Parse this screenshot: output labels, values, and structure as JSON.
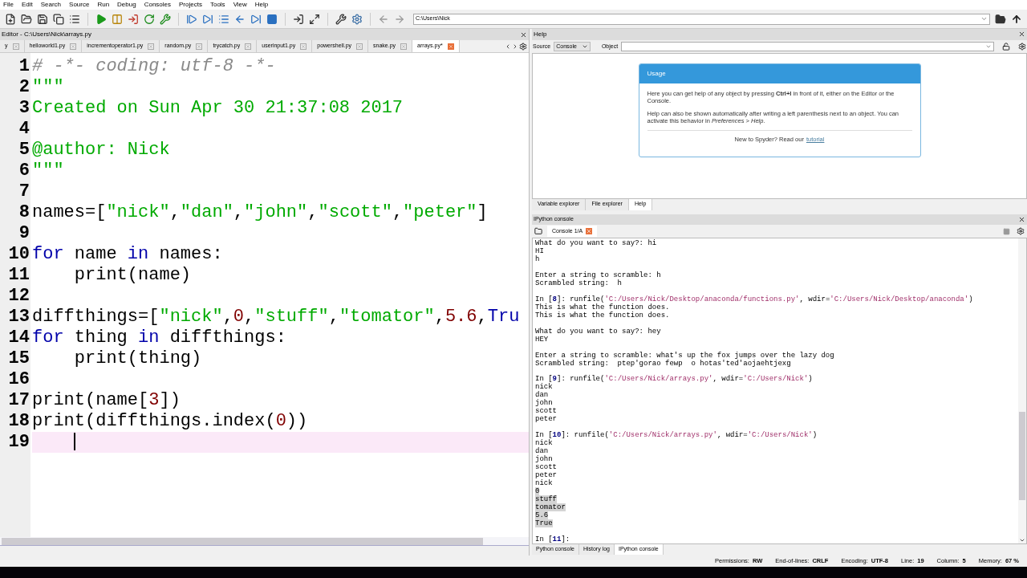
{
  "menu": [
    "File",
    "Edit",
    "Search",
    "Source",
    "Run",
    "Debug",
    "Consoles",
    "Projects",
    "Tools",
    "View",
    "Help"
  ],
  "path_field": {
    "value": "C:\\Users\\Nick"
  },
  "editor": {
    "title": "Editor - C:\\Users\\Nick\\arrays.py",
    "tabs": [
      {
        "label": "y",
        "selected": false
      },
      {
        "label": "helloworld1.py",
        "selected": false
      },
      {
        "label": "incrementoperator1.py",
        "selected": false
      },
      {
        "label": "random.py",
        "selected": false
      },
      {
        "label": "trycatch.py",
        "selected": false
      },
      {
        "label": "userinput1.py",
        "selected": false
      },
      {
        "label": "powershell.py",
        "selected": false
      },
      {
        "label": "snake.py",
        "selected": false
      },
      {
        "label": "arrays.py*",
        "selected": true
      }
    ],
    "lines": [
      {
        "number": "1",
        "current": false,
        "tokens": [
          {
            "text": "# -*- coding: utf-8 -*-",
            "kind": "comment"
          }
        ]
      },
      {
        "number": "2",
        "current": false,
        "tokens": [
          {
            "text": "\"\"\"",
            "kind": "string"
          }
        ]
      },
      {
        "number": "3",
        "current": false,
        "tokens": [
          {
            "text": "Created on Sun Apr 30 21:37:08 2017",
            "kind": "string"
          }
        ]
      },
      {
        "number": "4",
        "current": false
      },
      {
        "number": "5",
        "current": false,
        "tokens": [
          {
            "text": "@author: Nick",
            "kind": "string"
          }
        ]
      },
      {
        "number": "6",
        "current": false,
        "tokens": [
          {
            "text": "\"\"\"",
            "kind": "string"
          }
        ]
      },
      {
        "number": "7",
        "current": false
      },
      {
        "number": "8",
        "current": false,
        "tokens": [
          {
            "text": "names=[",
            "kind": "plain"
          },
          {
            "text": "\"nick\"",
            "kind": "string"
          },
          {
            "text": ",",
            "kind": "plain"
          },
          {
            "text": "\"dan\"",
            "kind": "string"
          },
          {
            "text": ",",
            "kind": "plain"
          },
          {
            "text": "\"john\"",
            "kind": "string"
          },
          {
            "text": ",",
            "kind": "plain"
          },
          {
            "text": "\"scott\"",
            "kind": "string"
          },
          {
            "text": ",",
            "kind": "plain"
          },
          {
            "text": "\"peter\"",
            "kind": "string"
          },
          {
            "text": "]",
            "kind": "plain"
          }
        ]
      },
      {
        "number": "9",
        "current": false
      },
      {
        "number": "10",
        "current": false,
        "tokens": [
          {
            "text": "for",
            "kind": "keyword"
          },
          {
            "text": " name ",
            "kind": "plain"
          },
          {
            "text": "in",
            "kind": "keyword"
          },
          {
            "text": " names:",
            "kind": "plain"
          }
        ]
      },
      {
        "number": "11",
        "current": false,
        "tokens": [
          {
            "text": "    print(name)",
            "kind": "plain"
          }
        ]
      },
      {
        "number": "12",
        "current": false
      },
      {
        "number": "13",
        "current": false,
        "tokens": [
          {
            "text": "diffthings=[",
            "kind": "plain"
          },
          {
            "text": "\"nick\"",
            "kind": "string"
          },
          {
            "text": ",",
            "kind": "plain"
          },
          {
            "text": "0",
            "kind": "number"
          },
          {
            "text": ",",
            "kind": "plain"
          },
          {
            "text": "\"stuff\"",
            "kind": "string"
          },
          {
            "text": ",",
            "kind": "plain"
          },
          {
            "text": "\"tomator\"",
            "kind": "string"
          },
          {
            "text": ",",
            "kind": "plain"
          },
          {
            "text": "5.6",
            "kind": "number"
          },
          {
            "text": ",",
            "kind": "plain"
          },
          {
            "text": "Tru",
            "kind": "keyword"
          }
        ]
      },
      {
        "number": "14",
        "current": false,
        "tokens": [
          {
            "text": "for",
            "kind": "keyword"
          },
          {
            "text": " thing ",
            "kind": "plain"
          },
          {
            "text": "in",
            "kind": "keyword"
          },
          {
            "text": " diffthings:",
            "kind": "plain"
          }
        ]
      },
      {
        "number": "15",
        "current": false,
        "tokens": [
          {
            "text": "    print(thing)",
            "kind": "plain"
          }
        ]
      },
      {
        "number": "16",
        "current": false
      },
      {
        "number": "17",
        "current": false,
        "tokens": [
          {
            "text": "print(name[",
            "kind": "plain"
          },
          {
            "text": "3",
            "kind": "number"
          },
          {
            "text": "])",
            "kind": "plain"
          }
        ]
      },
      {
        "number": "18",
        "current": false,
        "tokens": [
          {
            "text": "print(diffthings.index(",
            "kind": "plain"
          },
          {
            "text": "0",
            "kind": "number"
          },
          {
            "text": "))",
            "kind": "plain"
          }
        ]
      },
      {
        "number": "19",
        "current": true
      }
    ]
  },
  "help": {
    "title": "Help",
    "source_label": "Source",
    "source_value": "Console",
    "object_label": "Object",
    "usage": {
      "title": "Usage",
      "paragraphs": [
        "Here you can get help of any object by pressing **Ctrl+I** in front of it, either on the Editor or the Console.",
        "Help can also be shown automatically after writing a left parenthesis next to an object. You can activate this behavior in *Preferences* > *Help*."
      ],
      "footer": "New to Spyder? Read our",
      "link": "tutorial"
    },
    "tabs": [
      {
        "label": "Variable explorer",
        "selected": false
      },
      {
        "label": "File explorer",
        "selected": false
      },
      {
        "label": "Help",
        "selected": true
      }
    ]
  },
  "console": {
    "title": "IPython console",
    "tab": "Console 1/A",
    "lines": [
      {
        "kind": "text",
        "selected": false,
        "segments": [
          {
            "text": "What do you want to say?: hi",
            "kind": "plain"
          }
        ]
      },
      {
        "kind": "text",
        "selected": false,
        "segments": [
          {
            "text": "HI",
            "kind": "plain"
          }
        ]
      },
      {
        "kind": "text",
        "selected": false,
        "segments": [
          {
            "text": "h",
            "kind": "plain"
          }
        ]
      },
      {
        "kind": "blank"
      },
      {
        "kind": "text",
        "selected": false,
        "segments": [
          {
            "text": "Enter a string to scramble: h",
            "kind": "plain"
          }
        ]
      },
      {
        "kind": "text",
        "selected": false,
        "segments": [
          {
            "text": "Scrambled string:  h",
            "kind": "plain"
          }
        ]
      },
      {
        "kind": "blank"
      },
      {
        "kind": "text",
        "selected": false,
        "segments": [
          {
            "text": "In [",
            "kind": "plain"
          },
          {
            "text": "8",
            "kind": "number"
          },
          {
            "text": "]: runfile(",
            "kind": "plain"
          },
          {
            "text": "'C:/Users/Nick/Desktop/anaconda/functions.py'",
            "kind": "string"
          },
          {
            "text": ", wdir=",
            "kind": "plain"
          },
          {
            "text": "'C:/Users/Nick/Desktop/anaconda'",
            "kind": "string"
          },
          {
            "text": ")",
            "kind": "plain"
          }
        ]
      },
      {
        "kind": "text",
        "selected": false,
        "segments": [
          {
            "text": "This is what the function does.",
            "kind": "plain"
          }
        ]
      },
      {
        "kind": "text",
        "selected": false,
        "segments": [
          {
            "text": "This is what the function does.",
            "kind": "plain"
          }
        ]
      },
      {
        "kind": "blank"
      },
      {
        "kind": "text",
        "selected": false,
        "segments": [
          {
            "text": "What do you want to say?: hey",
            "kind": "plain"
          }
        ]
      },
      {
        "kind": "text",
        "selected": false,
        "segments": [
          {
            "text": "HEY",
            "kind": "plain"
          }
        ]
      },
      {
        "kind": "blank"
      },
      {
        "kind": "text",
        "selected": false,
        "segments": [
          {
            "text": "Enter a string to scramble: what's up the fox jumps over the lazy dog",
            "kind": "plain"
          }
        ]
      },
      {
        "kind": "text",
        "selected": false,
        "segments": [
          {
            "text": "Scrambled string:  ptep'gorao fewp  o hotas'ted'aojaehtjexg",
            "kind": "plain"
          }
        ]
      },
      {
        "kind": "blank"
      },
      {
        "kind": "text",
        "selected": false,
        "segments": [
          {
            "text": "In [",
            "kind": "plain"
          },
          {
            "text": "9",
            "kind": "number"
          },
          {
            "text": "]: runfile(",
            "kind": "plain"
          },
          {
            "text": "'C:/Users/Nick/arrays.py'",
            "kind": "string"
          },
          {
            "text": ", wdir=",
            "kind": "plain"
          },
          {
            "text": "'C:/Users/Nick'",
            "kind": "string"
          },
          {
            "text": ")",
            "kind": "plain"
          }
        ]
      },
      {
        "kind": "text",
        "selected": false,
        "segments": [
          {
            "text": "nick",
            "kind": "plain"
          }
        ]
      },
      {
        "kind": "text",
        "selected": false,
        "segments": [
          {
            "text": "dan",
            "kind": "plain"
          }
        ]
      },
      {
        "kind": "text",
        "selected": false,
        "segments": [
          {
            "text": "john",
            "kind": "plain"
          }
        ]
      },
      {
        "kind": "text",
        "selected": false,
        "segments": [
          {
            "text": "scott",
            "kind": "plain"
          }
        ]
      },
      {
        "kind": "text",
        "selected": false,
        "segments": [
          {
            "text": "peter",
            "kind": "plain"
          }
        ]
      },
      {
        "kind": "blank"
      },
      {
        "kind": "text",
        "selected": false,
        "segments": [
          {
            "text": "In [",
            "kind": "plain"
          },
          {
            "text": "10",
            "kind": "number"
          },
          {
            "text": "]: runfile(",
            "kind": "plain"
          },
          {
            "text": "'C:/Users/Nick/arrays.py'",
            "kind": "string"
          },
          {
            "text": ", wdir=",
            "kind": "plain"
          },
          {
            "text": "'C:/Users/Nick'",
            "kind": "string"
          },
          {
            "text": ")",
            "kind": "plain"
          }
        ]
      },
      {
        "kind": "text",
        "selected": false,
        "segments": [
          {
            "text": "nick",
            "kind": "plain"
          }
        ]
      },
      {
        "kind": "text",
        "selected": false,
        "segments": [
          {
            "text": "dan",
            "kind": "plain"
          }
        ]
      },
      {
        "kind": "text",
        "selected": false,
        "segments": [
          {
            "text": "john",
            "kind": "plain"
          }
        ]
      },
      {
        "kind": "text",
        "selected": false,
        "segments": [
          {
            "text": "scott",
            "kind": "plain"
          }
        ]
      },
      {
        "kind": "text",
        "selected": false,
        "segments": [
          {
            "text": "peter",
            "kind": "plain"
          }
        ]
      },
      {
        "kind": "text",
        "selected": false,
        "segments": [
          {
            "text": "nick",
            "kind": "plain"
          }
        ]
      },
      {
        "kind": "text",
        "selected": true,
        "segments": [
          {
            "text": "0",
            "kind": "plain"
          }
        ]
      },
      {
        "kind": "text",
        "selected": true,
        "segments": [
          {
            "text": "stuff",
            "kind": "plain"
          }
        ]
      },
      {
        "kind": "text",
        "selected": true,
        "segments": [
          {
            "text": "tomator",
            "kind": "plain"
          }
        ]
      },
      {
        "kind": "text",
        "selected": true,
        "segments": [
          {
            "text": "5.6",
            "kind": "plain"
          }
        ]
      },
      {
        "kind": "text",
        "selected": true,
        "segments": [
          {
            "text": "True",
            "kind": "plain"
          }
        ]
      },
      {
        "kind": "blank"
      },
      {
        "kind": "text",
        "selected": false,
        "segments": [
          {
            "text": "In [",
            "kind": "plain"
          },
          {
            "text": "11",
            "kind": "number"
          },
          {
            "text": "]:",
            "kind": "plain"
          }
        ]
      }
    ]
  },
  "bottom_tabs": [
    {
      "label": "Python console",
      "selected": false
    },
    {
      "label": "History log",
      "selected": false
    },
    {
      "label": "IPython console",
      "selected": true
    }
  ],
  "status_bar": [
    {
      "label": "Permissions:",
      "value": "RW"
    },
    {
      "label": "End-of-lines:",
      "value": "CRLF"
    },
    {
      "label": "Encoding:",
      "value": "UTF-8"
    },
    {
      "label": "Line:",
      "value": "19"
    },
    {
      "label": "Column:",
      "value": "5"
    },
    {
      "label": "Memory:",
      "value": "67 %"
    }
  ]
}
